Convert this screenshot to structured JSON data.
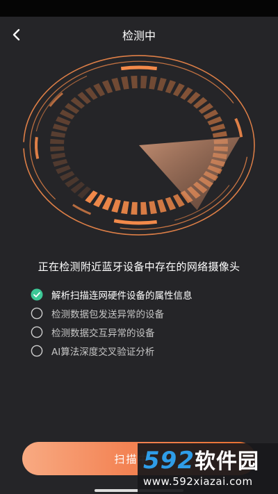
{
  "header": {
    "title": "检测中",
    "back_icon": "chevron-left-icon"
  },
  "radar": {
    "accent_color": "#f38a4a",
    "progress_fraction": 0.6
  },
  "headline": "正在检测附近蓝牙设备中存在的网络摄像头",
  "steps": [
    {
      "label": "解析扫描连网硬件设备的属性信息",
      "status": "done"
    },
    {
      "label": "检测数据包发送异常的设备",
      "status": "pending"
    },
    {
      "label": "检测数据交互异常的设备",
      "status": "pending"
    },
    {
      "label": "AI算法深度交叉验证分析",
      "status": "pending"
    }
  ],
  "scan_button": {
    "label": "扫描中..."
  },
  "watermark": {
    "logo_number": "592",
    "logo_text": "软件园",
    "url": "www.592xiazai.com"
  },
  "colors": {
    "background": "#252528",
    "accent": "#f38a4a",
    "check_green": "#3cc796",
    "button_start": "#f8aa82",
    "button_end": "#e8702f"
  }
}
